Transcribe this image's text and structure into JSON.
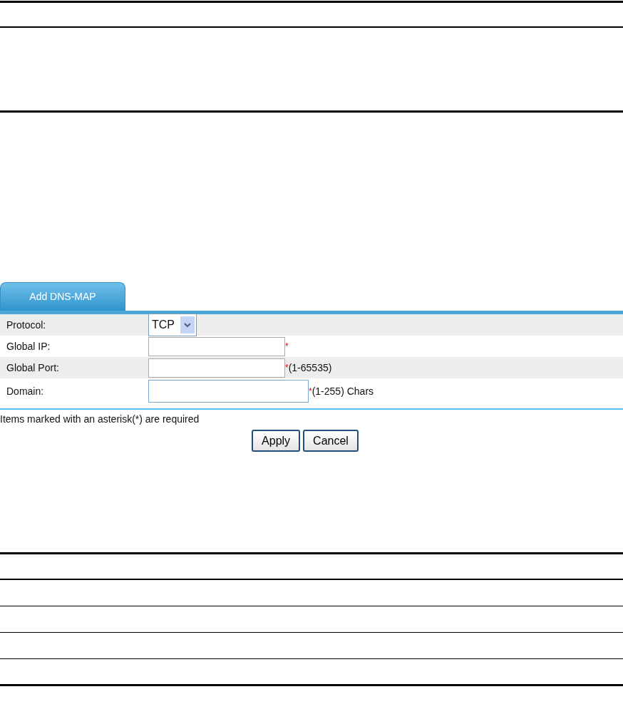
{
  "tab": {
    "label": "Add DNS-MAP",
    "selected": true
  },
  "fields": [
    {
      "label": "Protocol:",
      "kind": "select",
      "value": "TCP",
      "required": false
    },
    {
      "label": "Global IP:",
      "kind": "text",
      "required": true,
      "focused": false
    },
    {
      "label": "Global Port:",
      "kind": "text",
      "required": true,
      "hint": "(1-65535)",
      "focused": false
    },
    {
      "label": "Domain:",
      "kind": "text",
      "required": true,
      "hint": "(1-255) Chars",
      "focused": true,
      "wide": true
    }
  ],
  "required_asterisk": "*",
  "note": "Items marked with an asterisk(*) are required",
  "buttons": [
    "Apply",
    "Cancel"
  ]
}
